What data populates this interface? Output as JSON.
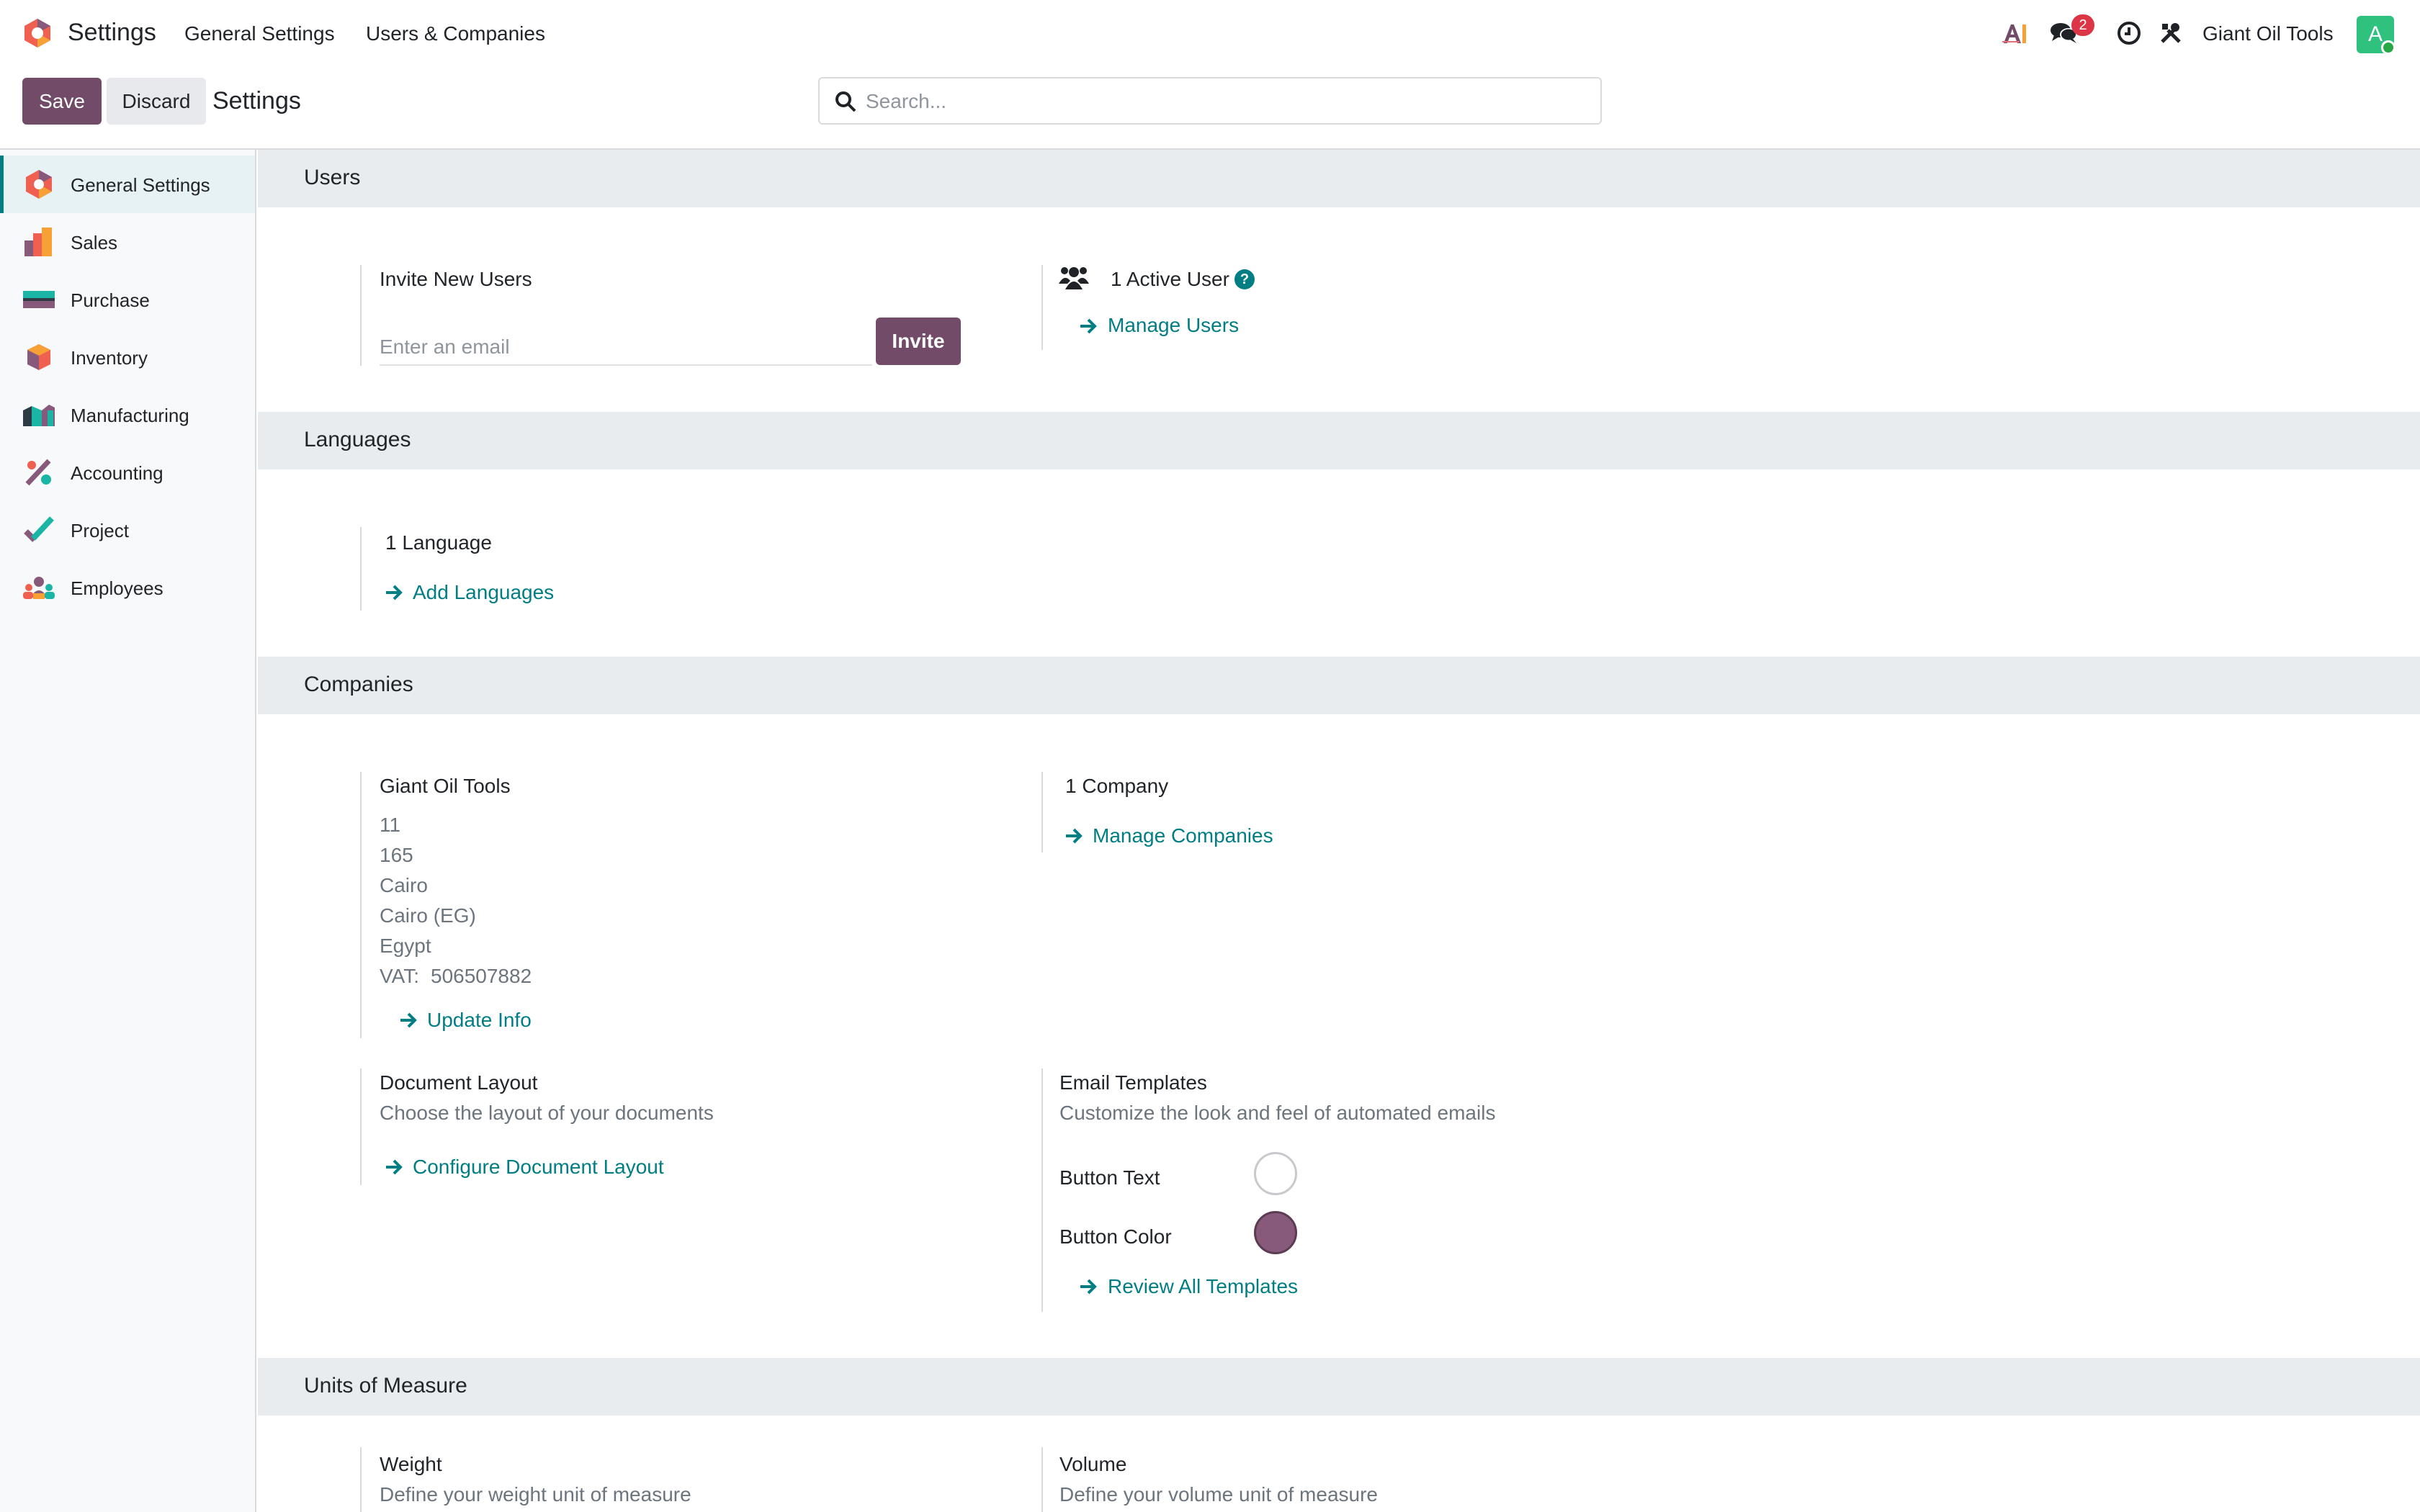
{
  "navbar": {
    "app_title": "Settings",
    "menu_general": "General Settings",
    "menu_users": "Users & Companies",
    "message_count": "2",
    "company_name": "Giant Oil Tools",
    "avatar_letter": "A"
  },
  "control_panel": {
    "save_label": "Save",
    "discard_label": "Discard",
    "title": "Settings",
    "search_placeholder": "Search..."
  },
  "sidebar": {
    "items": [
      {
        "label": "General Settings",
        "icon": "settings-icon"
      },
      {
        "label": "Sales",
        "icon": "sales-icon"
      },
      {
        "label": "Purchase",
        "icon": "purchase-icon"
      },
      {
        "label": "Inventory",
        "icon": "inventory-icon"
      },
      {
        "label": "Manufacturing",
        "icon": "manufacturing-icon"
      },
      {
        "label": "Accounting",
        "icon": "accounting-icon"
      },
      {
        "label": "Project",
        "icon": "project-icon"
      },
      {
        "label": "Employees",
        "icon": "employees-icon"
      }
    ]
  },
  "users": {
    "header": "Users",
    "invite_title": "Invite New Users",
    "email_placeholder": "Enter an email",
    "invite_button": "Invite",
    "active_users": "1 Active User",
    "manage_users": "Manage Users"
  },
  "languages": {
    "header": "Languages",
    "count": "1 Language",
    "add_languages": "Add Languages"
  },
  "companies": {
    "header": "Companies",
    "company_name": "Giant Oil Tools",
    "address_lines": [
      "11",
      "165",
      "Cairo",
      "Cairo (EG)",
      "Egypt"
    ],
    "vat_label": "VAT:",
    "vat_value": "506507882",
    "update_info": "Update Info",
    "count": "1 Company",
    "manage_companies": "Manage Companies",
    "document_layout_title": "Document Layout",
    "document_layout_desc": "Choose the layout of your documents",
    "configure_layout": "Configure Document Layout",
    "email_templates_title": "Email Templates",
    "email_templates_desc": "Customize the look and feel of automated emails",
    "button_text_label": "Button Text",
    "button_text_color": "#ffffff",
    "button_color_label": "Button Color",
    "button_color": "#875a7b",
    "review_templates": "Review All Templates"
  },
  "uom": {
    "header": "Units of Measure",
    "weight_title": "Weight",
    "weight_desc": "Define your weight unit of measure",
    "volume_title": "Volume",
    "volume_desc": "Define your volume unit of measure"
  },
  "colors": {
    "primary": "#714b67",
    "link": "#017e84",
    "badge": "#dc3545"
  }
}
